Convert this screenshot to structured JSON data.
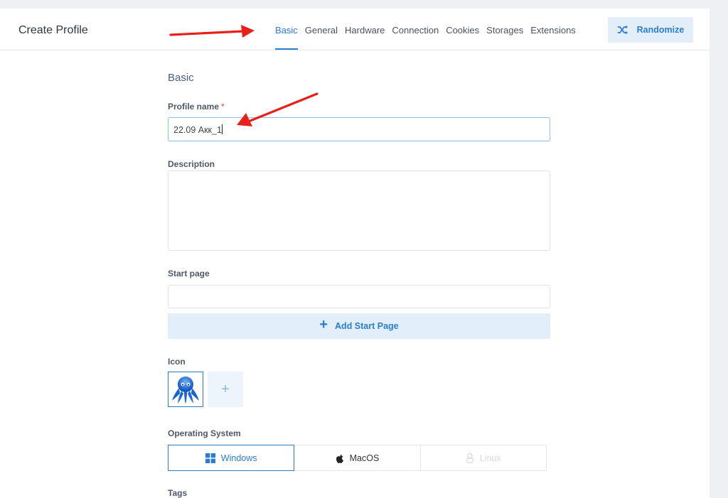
{
  "header": {
    "title": "Create Profile",
    "tabs": [
      {
        "label": "Basic",
        "active": true
      },
      {
        "label": "General"
      },
      {
        "label": "Hardware"
      },
      {
        "label": "Connection"
      },
      {
        "label": "Cookies"
      },
      {
        "label": "Storages"
      },
      {
        "label": "Extensions"
      }
    ],
    "randomize_label": "Randomize"
  },
  "form": {
    "section_title": "Basic",
    "profile_name": {
      "label": "Profile name",
      "required_mark": "*",
      "value": "22.09 Акк_1"
    },
    "description": {
      "label": "Description",
      "value": ""
    },
    "start_page": {
      "label": "Start page",
      "value": "",
      "add_label": "Add Start Page"
    },
    "icon": {
      "label": "Icon",
      "add_symbol": "+"
    },
    "operating_system": {
      "label": "Operating System",
      "options": [
        {
          "label": "Windows",
          "icon": "windows-icon",
          "selected": true
        },
        {
          "label": "MacOS",
          "icon": "apple-icon"
        },
        {
          "label": "Linux",
          "icon": "linux-icon",
          "disabled": true
        }
      ]
    },
    "tags": {
      "label": "Tags"
    }
  },
  "colors": {
    "accent": "#2b7cd3",
    "accent_light": "#e2effb",
    "annotation_arrow": "#e8201a"
  }
}
